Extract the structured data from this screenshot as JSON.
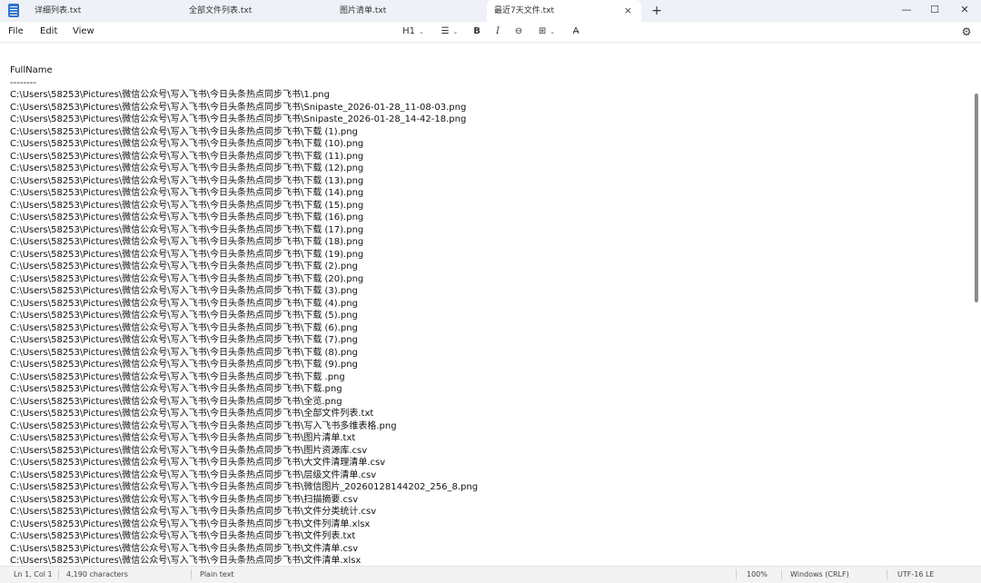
{
  "tabs": [
    {
      "label": "详细列表.txt"
    },
    {
      "label": "全部文件列表.txt"
    },
    {
      "label": "图片清单.txt"
    },
    {
      "label": "最近7天文件.txt",
      "active": true
    }
  ],
  "icons": {
    "app": "notepad-icon",
    "close_tab": "×",
    "new_tab": "+",
    "minimize": "—",
    "maximize": "☐",
    "close_window": "✕",
    "settings": "gear-icon"
  },
  "menu": {
    "file": "File",
    "edit": "Edit",
    "view": "View"
  },
  "toolbar": {
    "heading": "H1",
    "list_glyph": "☰",
    "bold": "B",
    "italic": "I",
    "link": "⊖",
    "table": "⊞",
    "clear_format": "A̶",
    "settings": "⚙"
  },
  "document": {
    "content": "FullName\n--------\nC:\\Users\\58253\\Pictures\\微信公众号\\写入飞书\\今日头条热点同步飞书\\1.png\nC:\\Users\\58253\\Pictures\\微信公众号\\写入飞书\\今日头条热点同步飞书\\Snipaste_2026-01-28_11-08-03.png\nC:\\Users\\58253\\Pictures\\微信公众号\\写入飞书\\今日头条热点同步飞书\\Snipaste_2026-01-28_14-42-18.png\nC:\\Users\\58253\\Pictures\\微信公众号\\写入飞书\\今日头条热点同步飞书\\下载 (1).png\nC:\\Users\\58253\\Pictures\\微信公众号\\写入飞书\\今日头条热点同步飞书\\下载 (10).png\nC:\\Users\\58253\\Pictures\\微信公众号\\写入飞书\\今日头条热点同步飞书\\下载 (11).png\nC:\\Users\\58253\\Pictures\\微信公众号\\写入飞书\\今日头条热点同步飞书\\下载 (12).png\nC:\\Users\\58253\\Pictures\\微信公众号\\写入飞书\\今日头条热点同步飞书\\下载 (13).png\nC:\\Users\\58253\\Pictures\\微信公众号\\写入飞书\\今日头条热点同步飞书\\下载 (14).png\nC:\\Users\\58253\\Pictures\\微信公众号\\写入飞书\\今日头条热点同步飞书\\下载 (15).png\nC:\\Users\\58253\\Pictures\\微信公众号\\写入飞书\\今日头条热点同步飞书\\下载 (16).png\nC:\\Users\\58253\\Pictures\\微信公众号\\写入飞书\\今日头条热点同步飞书\\下载 (17).png\nC:\\Users\\58253\\Pictures\\微信公众号\\写入飞书\\今日头条热点同步飞书\\下载 (18).png\nC:\\Users\\58253\\Pictures\\微信公众号\\写入飞书\\今日头条热点同步飞书\\下载 (19).png\nC:\\Users\\58253\\Pictures\\微信公众号\\写入飞书\\今日头条热点同步飞书\\下载 (2).png\nC:\\Users\\58253\\Pictures\\微信公众号\\写入飞书\\今日头条热点同步飞书\\下载 (20).png\nC:\\Users\\58253\\Pictures\\微信公众号\\写入飞书\\今日头条热点同步飞书\\下载 (3).png\nC:\\Users\\58253\\Pictures\\微信公众号\\写入飞书\\今日头条热点同步飞书\\下载 (4).png\nC:\\Users\\58253\\Pictures\\微信公众号\\写入飞书\\今日头条热点同步飞书\\下载 (5).png\nC:\\Users\\58253\\Pictures\\微信公众号\\写入飞书\\今日头条热点同步飞书\\下载 (6).png\nC:\\Users\\58253\\Pictures\\微信公众号\\写入飞书\\今日头条热点同步飞书\\下载 (7).png\nC:\\Users\\58253\\Pictures\\微信公众号\\写入飞书\\今日头条热点同步飞书\\下载 (8).png\nC:\\Users\\58253\\Pictures\\微信公众号\\写入飞书\\今日头条热点同步飞书\\下载 (9).png\nC:\\Users\\58253\\Pictures\\微信公众号\\写入飞书\\今日头条热点同步飞书\\下载 .png\nC:\\Users\\58253\\Pictures\\微信公众号\\写入飞书\\今日头条热点同步飞书\\下载.png\nC:\\Users\\58253\\Pictures\\微信公众号\\写入飞书\\今日头条热点同步飞书\\全览.png\nC:\\Users\\58253\\Pictures\\微信公众号\\写入飞书\\今日头条热点同步飞书\\全部文件列表.txt\nC:\\Users\\58253\\Pictures\\微信公众号\\写入飞书\\今日头条热点同步飞书\\写入飞书多维表格.png\nC:\\Users\\58253\\Pictures\\微信公众号\\写入飞书\\今日头条热点同步飞书\\图片清单.txt\nC:\\Users\\58253\\Pictures\\微信公众号\\写入飞书\\今日头条热点同步飞书\\图片资源库.csv\nC:\\Users\\58253\\Pictures\\微信公众号\\写入飞书\\今日头条热点同步飞书\\大文件清理清单.csv\nC:\\Users\\58253\\Pictures\\微信公众号\\写入飞书\\今日头条热点同步飞书\\层级文件清单.csv\nC:\\Users\\58253\\Pictures\\微信公众号\\写入飞书\\今日头条热点同步飞书\\微信图片_20260128144202_256_8.png\nC:\\Users\\58253\\Pictures\\微信公众号\\写入飞书\\今日头条热点同步飞书\\扫描摘要.csv\nC:\\Users\\58253\\Pictures\\微信公众号\\写入飞书\\今日头条热点同步飞书\\文件分类统计.csv\nC:\\Users\\58253\\Pictures\\微信公众号\\写入飞书\\今日头条热点同步飞书\\文件列清单.xlsx\nC:\\Users\\58253\\Pictures\\微信公众号\\写入飞书\\今日头条热点同步飞书\\文件列表.txt\nC:\\Users\\58253\\Pictures\\微信公众号\\写入飞书\\今日头条热点同步飞书\\文件清单.csv\nC:\\Users\\58253\\Pictures\\微信公众号\\写入飞书\\今日头条热点同步飞书\\文件清单.xlsx"
  },
  "status": {
    "position": "Ln 1, Col 1",
    "characters": "4,190 characters",
    "format": "Plain text",
    "zoom": "100%",
    "line_ending": "Windows (CRLF)",
    "encoding": "UTF-16 LE"
  },
  "colors": {
    "titlebar": "#eef1f7",
    "accent": "#2f74d0"
  }
}
